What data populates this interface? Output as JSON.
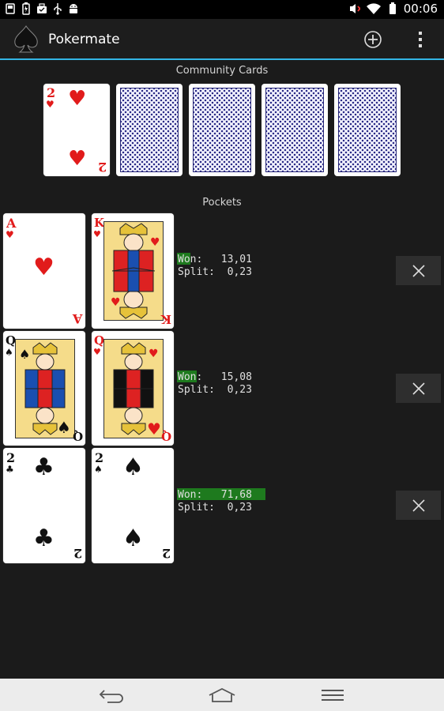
{
  "status_bar": {
    "time": "00:06",
    "icons": [
      "sd-card-icon",
      "battery-charging-icon",
      "briefcase-icon",
      "usb-icon",
      "android-icon"
    ],
    "right_icons": [
      "muted-volume-icon",
      "wifi-icon",
      "battery-icon"
    ]
  },
  "action_bar": {
    "title": "Pokermate",
    "app_icon": "spade-icon",
    "actions": [
      "add-icon",
      "overflow-menu-icon"
    ]
  },
  "community": {
    "label": "Community Cards",
    "cards": [
      {
        "rank": "2",
        "suit": "♥",
        "color": "red",
        "face_up": true
      },
      {
        "face_up": false
      },
      {
        "face_up": false
      },
      {
        "face_up": false
      },
      {
        "face_up": false
      }
    ]
  },
  "pockets": {
    "label": "Pockets",
    "hands": [
      {
        "cards": [
          {
            "rank": "A",
            "suit": "♥",
            "color": "red"
          },
          {
            "rank": "K",
            "suit": "♥",
            "color": "red",
            "court": true
          }
        ],
        "won_label": "Won:",
        "won_value": "13,01",
        "split_label": "Split:",
        "split_value": "0,23",
        "won_fraction": 0.1301
      },
      {
        "cards": [
          {
            "rank": "Q",
            "suit": "♠",
            "color": "black",
            "court": true
          },
          {
            "rank": "Q",
            "suit": "♥",
            "color": "red",
            "court": true
          }
        ],
        "won_label": "Won:",
        "won_value": "15,08",
        "split_label": "Split:",
        "split_value": "0,23",
        "won_fraction": 0.1508
      },
      {
        "cards": [
          {
            "rank": "2",
            "suit": "♣",
            "color": "black"
          },
          {
            "rank": "2",
            "suit": "♠",
            "color": "black"
          }
        ],
        "won_label": "Won:",
        "won_value": "71,68",
        "split_label": "Split:",
        "split_value": "0,23",
        "won_fraction": 0.7168
      }
    ]
  },
  "colors": {
    "accent": "#33b5e5",
    "won_bar": "#1e7a1e",
    "card_red": "#e11b1b",
    "card_back": "#2b2b86"
  },
  "nav_bar": {
    "buttons": [
      "back-icon",
      "home-icon",
      "recent-apps-icon"
    ]
  }
}
